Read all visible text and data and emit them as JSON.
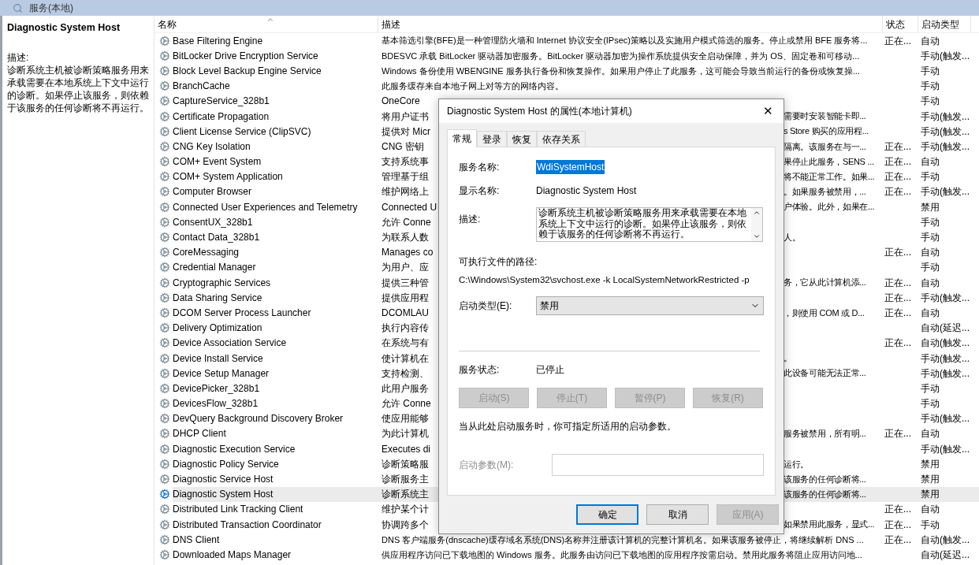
{
  "window": {
    "title": "服务(本地)"
  },
  "detail_panel": {
    "title": "Diagnostic System Host",
    "description_label": "描述:",
    "description": "诊断系统主机被诊断策略服务用来承载需要在本地系统上下文中运行的诊断。如果停止该服务，则依赖于该服务的任何诊断将不再运行。"
  },
  "table": {
    "columns": [
      {
        "label": "名称",
        "sorted": true
      },
      {
        "label": "描述",
        "sorted": false
      },
      {
        "label": "状态",
        "sorted": false
      },
      {
        "label": "启动类型",
        "sorted": false
      }
    ],
    "rows": [
      {
        "name": "Base Filtering Engine",
        "description": "基本筛选引擎(BFE)是一种管理防火墙和 Internet 协议安全(IPsec)策略以及实施用户模式筛选的服务。停止或禁用 BFE 服务将...",
        "status": "正在...",
        "startup": "自动",
        "selected": false
      },
      {
        "name": "BitLocker Drive Encryption Service",
        "description": "BDESVC 承载 BitLocker 驱动器加密服务。BitLocker 驱动器加密为操作系统提供安全启动保障，并为 OS、固定卷和可移动...",
        "status": "",
        "startup": "手动(触发...",
        "selected": false
      },
      {
        "name": "Block Level Backup Engine Service",
        "description": "Windows 备份使用 WBENGINE 服务执行备份和恢复操作。如果用户停止了此服务，这可能会导致当前运行的备份或恢复操...",
        "status": "",
        "startup": "手动",
        "selected": false
      },
      {
        "name": "BranchCache",
        "description": "此服务缓存来自本地子网上对等方的网络内容。",
        "status": "",
        "startup": "手动",
        "selected": false
      },
      {
        "name": "CaptureService_328b1",
        "description_start": "OneCore",
        "description_end": "",
        "status": "",
        "startup": "手动",
        "selected": false
      },
      {
        "name": "Certificate Propagation",
        "description_start": "将用户证书",
        "description_end": "需要时安装智能卡即...",
        "status": "",
        "startup": "手动(触发...",
        "selected": false
      },
      {
        "name": "Client License Service (ClipSVC)",
        "description_start": "提供对 Micr",
        "description_end": "s Store 购买的应用程...",
        "status": "",
        "startup": "手动(触发...",
        "selected": false
      },
      {
        "name": "CNG Key Isolation",
        "description_start": "CNG 密钥",
        "description_end": "隔离。该服务在与一...",
        "status": "正在...",
        "startup": "手动(触发...",
        "selected": false
      },
      {
        "name": "COM+ Event System",
        "description_start": "支持系统事",
        "description_end": "果停止此服务，SENS ...",
        "status": "正在...",
        "startup": "自动",
        "selected": false
      },
      {
        "name": "COM+ System Application",
        "description_start": "管理基于组",
        "description_end": "将不能正常工作。如果...",
        "status": "正在...",
        "startup": "手动",
        "selected": false
      },
      {
        "name": "Computer Browser",
        "description_start": "维护网络上",
        "description_end": "。如果服务被禁用，...",
        "status": "正在...",
        "startup": "手动(触发...",
        "selected": false
      },
      {
        "name": "Connected User Experiences and Telemetry",
        "description_start": "Connected U",
        "description_end": "户体验。此外，如果在...",
        "status": "",
        "startup": "禁用",
        "selected": false
      },
      {
        "name": "ConsentUX_328b1",
        "description_start": "允许 Conne",
        "description_end": "",
        "status": "",
        "startup": "手动",
        "selected": false
      },
      {
        "name": "Contact Data_328b1",
        "description_start": "为联系人数",
        "description_end": "人。",
        "status": "",
        "startup": "手动",
        "selected": false
      },
      {
        "name": "CoreMessaging",
        "description_start": "Manages co",
        "description_end": "",
        "status": "正在...",
        "startup": "自动",
        "selected": false
      },
      {
        "name": "Credential Manager",
        "description_start": "为用户、应",
        "description_end": "",
        "status": "",
        "startup": "手动",
        "selected": false
      },
      {
        "name": "Cryptographic Services",
        "description_start": "提供三种管",
        "description_end": "务，它从此计算机添...",
        "status": "正在...",
        "startup": "自动",
        "selected": false
      },
      {
        "name": "Data Sharing Service",
        "description_start": "提供应用程",
        "description_end": "",
        "status": "正在...",
        "startup": "手动(触发...",
        "selected": false
      },
      {
        "name": "DCOM Server Process Launcher",
        "description_start": "DCOMLAU",
        "description_end": "，则使用 COM 或 D...",
        "status": "正在...",
        "startup": "自动",
        "selected": false
      },
      {
        "name": "Delivery Optimization",
        "description_start": "执行内容传",
        "description_end": "",
        "status": "",
        "startup": "自动(延迟...",
        "selected": false
      },
      {
        "name": "Device Association Service",
        "description_start": "在系统与有",
        "description_end": "",
        "status": "正在...",
        "startup": "自动(触发...",
        "selected": false
      },
      {
        "name": "Device Install Service",
        "description_start": "使计算机在",
        "description_end": "。",
        "status": "",
        "startup": "手动(触发...",
        "selected": false
      },
      {
        "name": "Device Setup Manager",
        "description_start": "支持检测、",
        "description_end": "此设备可能无法正常...",
        "status": "",
        "startup": "手动(触发...",
        "selected": false
      },
      {
        "name": "DevicePicker_328b1",
        "description_start": "此用户服务",
        "description_end": "",
        "status": "",
        "startup": "手动",
        "selected": false
      },
      {
        "name": "DevicesFlow_328b1",
        "description_start": "允许 Conne",
        "description_end": "",
        "status": "",
        "startup": "手动",
        "selected": false
      },
      {
        "name": "DevQuery Background Discovery Broker",
        "description_start": "使应用能够",
        "description_end": "",
        "status": "",
        "startup": "手动(触发...",
        "selected": false
      },
      {
        "name": "DHCP Client",
        "description_start": "为此计算机",
        "description_end": "服务被禁用，所有明...",
        "status": "正在...",
        "startup": "自动",
        "selected": false
      },
      {
        "name": "Diagnostic Execution Service",
        "description_start": "Executes di",
        "description_end": "",
        "status": "",
        "startup": "手动(触发...",
        "selected": false
      },
      {
        "name": "Diagnostic Policy Service",
        "description_start": "诊断策略服",
        "description_end": "运行。",
        "status": "",
        "startup": "禁用",
        "selected": false
      },
      {
        "name": "Diagnostic Service Host",
        "description_start": "诊断服务主",
        "description_end": "该服务的任何诊断将...",
        "status": "",
        "startup": "禁用",
        "selected": false
      },
      {
        "name": "Diagnostic System Host",
        "description_start": "诊断系统主",
        "description_end": "该服务的任何诊断将...",
        "status": "",
        "startup": "禁用",
        "selected": true
      },
      {
        "name": "Distributed Link Tracking Client",
        "description_start": "维护某个计",
        "description_end": "",
        "status": "正在...",
        "startup": "自动",
        "selected": false
      },
      {
        "name": "Distributed Transaction Coordinator",
        "description_start": "协调跨多个",
        "description_end": "如果禁用此服务，显式...",
        "status": "正在...",
        "startup": "手动",
        "selected": false
      },
      {
        "name": "DNS Client",
        "description": "DNS 客户端服务(dnscache)缓存域名系统(DNS)名称并注册该计算机的完整计算机名。如果该服务被停止，将继续解析 DNS ...",
        "status": "正在...",
        "startup": "自动(触发...",
        "selected": false
      },
      {
        "name": "Downloaded Maps Manager",
        "description": "供应用程序访问已下载地图的 Windows 服务。此服务由访问已下载地图的应用程序按需启动。禁用此服务将阻止应用访问地...",
        "status": "",
        "startup": "自动(延迟...",
        "selected": false
      }
    ]
  },
  "dialog": {
    "title": "Diagnostic System Host 的属性(本地计算机)",
    "close": "✕",
    "tabs": [
      {
        "label": "常规",
        "selected": true
      },
      {
        "label": "登录",
        "selected": false
      },
      {
        "label": "恢复",
        "selected": false
      },
      {
        "label": "依存关系",
        "selected": false
      }
    ],
    "service_name_label": "服务名称:",
    "service_name": "WdiSystemHost",
    "display_name_label": "显示名称:",
    "display_name": "Diagnostic System Host",
    "description_label": "描述:",
    "description": "诊断系统主机被诊断策略服务用来承载需要在本地系统上下文中运行的诊断。如果停止该服务，则依赖于该服务的任何诊断将不再运行。",
    "path_label": "可执行文件的路径:",
    "path": "C:\\Windows\\System32\\svchost.exe -k LocalSystemNetworkRestricted -p",
    "startup_type_label": "启动类型(E):",
    "startup_type": "禁用",
    "status_label": "服务状态:",
    "status": "已停止",
    "service_buttons": [
      {
        "label": "启动(S)",
        "disabled": true
      },
      {
        "label": "停止(T)",
        "disabled": true
      },
      {
        "label": "暂停(P)",
        "disabled": true
      },
      {
        "label": "恢复(R)",
        "disabled": true
      }
    ],
    "hint": "当从此处启动服务时，你可指定所适用的启动参数。",
    "params_label": "启动参数(M):",
    "params_disabled": true,
    "footer_buttons": [
      {
        "label": "确定",
        "disabled": false,
        "default": true
      },
      {
        "label": "取消",
        "disabled": false,
        "default": false
      },
      {
        "label": "应用(A)",
        "disabled": true,
        "default": false
      }
    ]
  }
}
